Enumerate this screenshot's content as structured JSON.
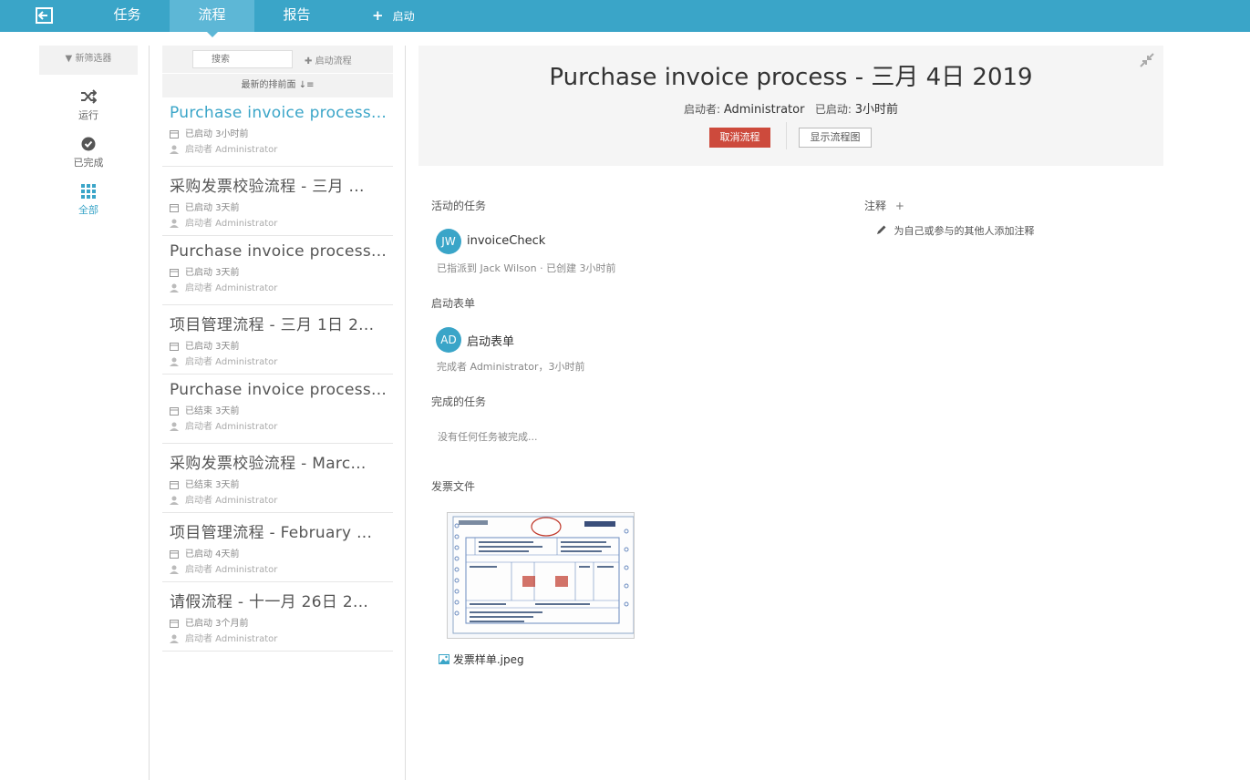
{
  "nav": {
    "tasks": "任务",
    "processes": "流程",
    "reports": "报告",
    "start": "启动",
    "accent": "#3aa5c8"
  },
  "filters": {
    "new_filter": "新筛选器",
    "running": "运行",
    "completed": "已完成",
    "all": "全部"
  },
  "list": {
    "search_placeholder": "搜索",
    "start_process": "启动流程",
    "sort": "最新的排前面",
    "items": [
      {
        "title": "Purchase invoice process...",
        "status": "已启动 3小时前",
        "starter": "启动者 Administrator"
      },
      {
        "title": "采购发票校验流程 - 三月 ...",
        "status": "已启动 3天前",
        "starter": "启动者 Administrator"
      },
      {
        "title": "Purchase invoice process...",
        "status": "已启动 3天前",
        "starter": "启动者 Administrator"
      },
      {
        "title": "项目管理流程 - 三月 1日 2...",
        "status": "已启动 3天前",
        "starter": "启动者 Administrator"
      },
      {
        "title": "Purchase invoice process...",
        "status": "已结束 3天前",
        "starter": "启动者 Administrator"
      },
      {
        "title": "采购发票校验流程 - Marc...",
        "status": "已结束 3天前",
        "starter": "启动者 Administrator"
      },
      {
        "title": "项目管理流程 - February ...",
        "status": "已启动 4天前",
        "starter": "启动者 Administrator"
      },
      {
        "title": "请假流程 - 十一月 26日 2...",
        "status": "已启动 3个月前",
        "starter": "启动者 Administrator"
      }
    ]
  },
  "detail": {
    "title": "Purchase invoice process - 三月 4日 2019",
    "starter_label": "启动者:",
    "starter": "Administrator",
    "started_label": "已启动:",
    "started": "3小时前",
    "cancel_button": "取消流程",
    "show_diagram_button": "显示流程图",
    "active_tasks_title": "活动的任务",
    "active_task": {
      "avatar": "JW",
      "name": "invoiceCheck",
      "meta": "已指派到 Jack Wilson · 已创建 3小时前"
    },
    "start_form_title": "启动表单",
    "start_form": {
      "avatar": "AD",
      "name": "启动表单",
      "meta": "完成者 Administrator，3小时前"
    },
    "completed_tasks_title": "完成的任务",
    "no_completed": "没有任何任务被完成...",
    "invoice_files_title": "发票文件",
    "file_name": "发票样单.jpeg",
    "notes_title": "注释",
    "notes_plus": "+",
    "add_note": "为自己或参与的其他人添加注释"
  }
}
